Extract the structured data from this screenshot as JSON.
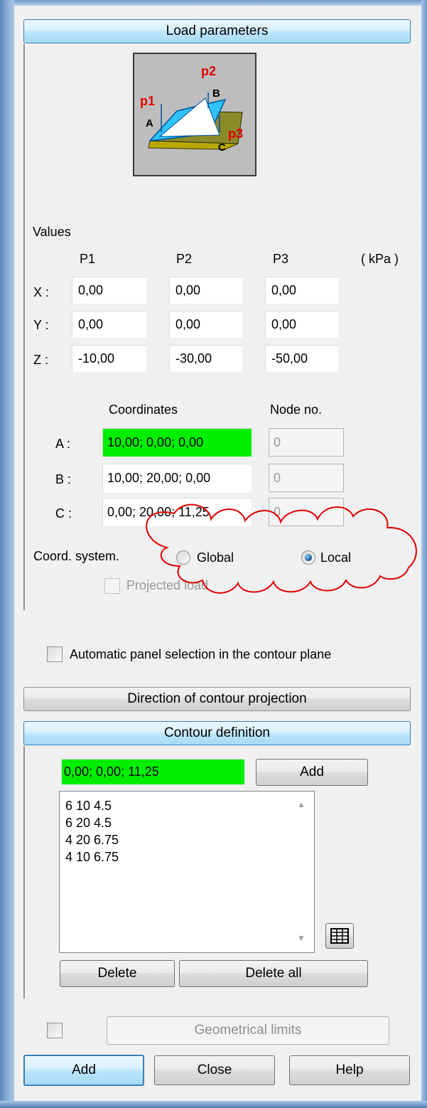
{
  "header": {
    "load_parameters": "Load parameters"
  },
  "illustration": {
    "p1": "p1",
    "p2": "p2",
    "p3": "p3",
    "a": "A",
    "b": "B",
    "c": "C"
  },
  "values": {
    "title": "Values",
    "unit": "( kPa )",
    "columns": [
      "P1",
      "P2",
      "P3"
    ],
    "rows": [
      {
        "label": "X :",
        "cells": [
          "0,00",
          "0,00",
          "0,00"
        ]
      },
      {
        "label": "Y :",
        "cells": [
          "0,00",
          "0,00",
          "0,00"
        ]
      },
      {
        "label": "Z :",
        "cells": [
          "-10,00",
          "-30,00",
          "-50,00"
        ]
      }
    ]
  },
  "coordinates": {
    "col_coordinates": "Coordinates",
    "col_node": "Node no.",
    "rows": [
      {
        "label": "A :",
        "value": "10,00; 0,00; 0,00",
        "node": "0"
      },
      {
        "label": "B :",
        "value": "10,00; 20,00; 0,00",
        "node": "0"
      },
      {
        "label": "C :",
        "value": "0,00; 20,00; 11,25",
        "node": "0"
      }
    ]
  },
  "coord_system": {
    "label": "Coord. system.",
    "options": [
      "Global",
      "Local"
    ],
    "selected": "Local",
    "projected_load": "Projected load"
  },
  "auto_panel": {
    "label": "Automatic panel selection in the contour plane",
    "checked": false
  },
  "direction_button": "Direction of contour projection",
  "contour": {
    "header": "Contour definition",
    "input_value": "0,00; 0,00; 11,25",
    "add_label": "Add",
    "items": [
      "6 10 4.5",
      "6 20 4.5",
      "4 20 6.75",
      "4 10 6.75"
    ],
    "delete_label": "Delete",
    "delete_all_label": "Delete all"
  },
  "geometrical_limits": "Geometrical limits",
  "footer": {
    "add": "Add",
    "close": "Close",
    "help": "Help"
  },
  "colors": {
    "highlight": "#00ee00",
    "accent": "#3c7fb1",
    "annotation": "#e00000"
  },
  "icons": [
    "table-grid-icon",
    "scroll-up-icon",
    "scroll-down-icon"
  ]
}
